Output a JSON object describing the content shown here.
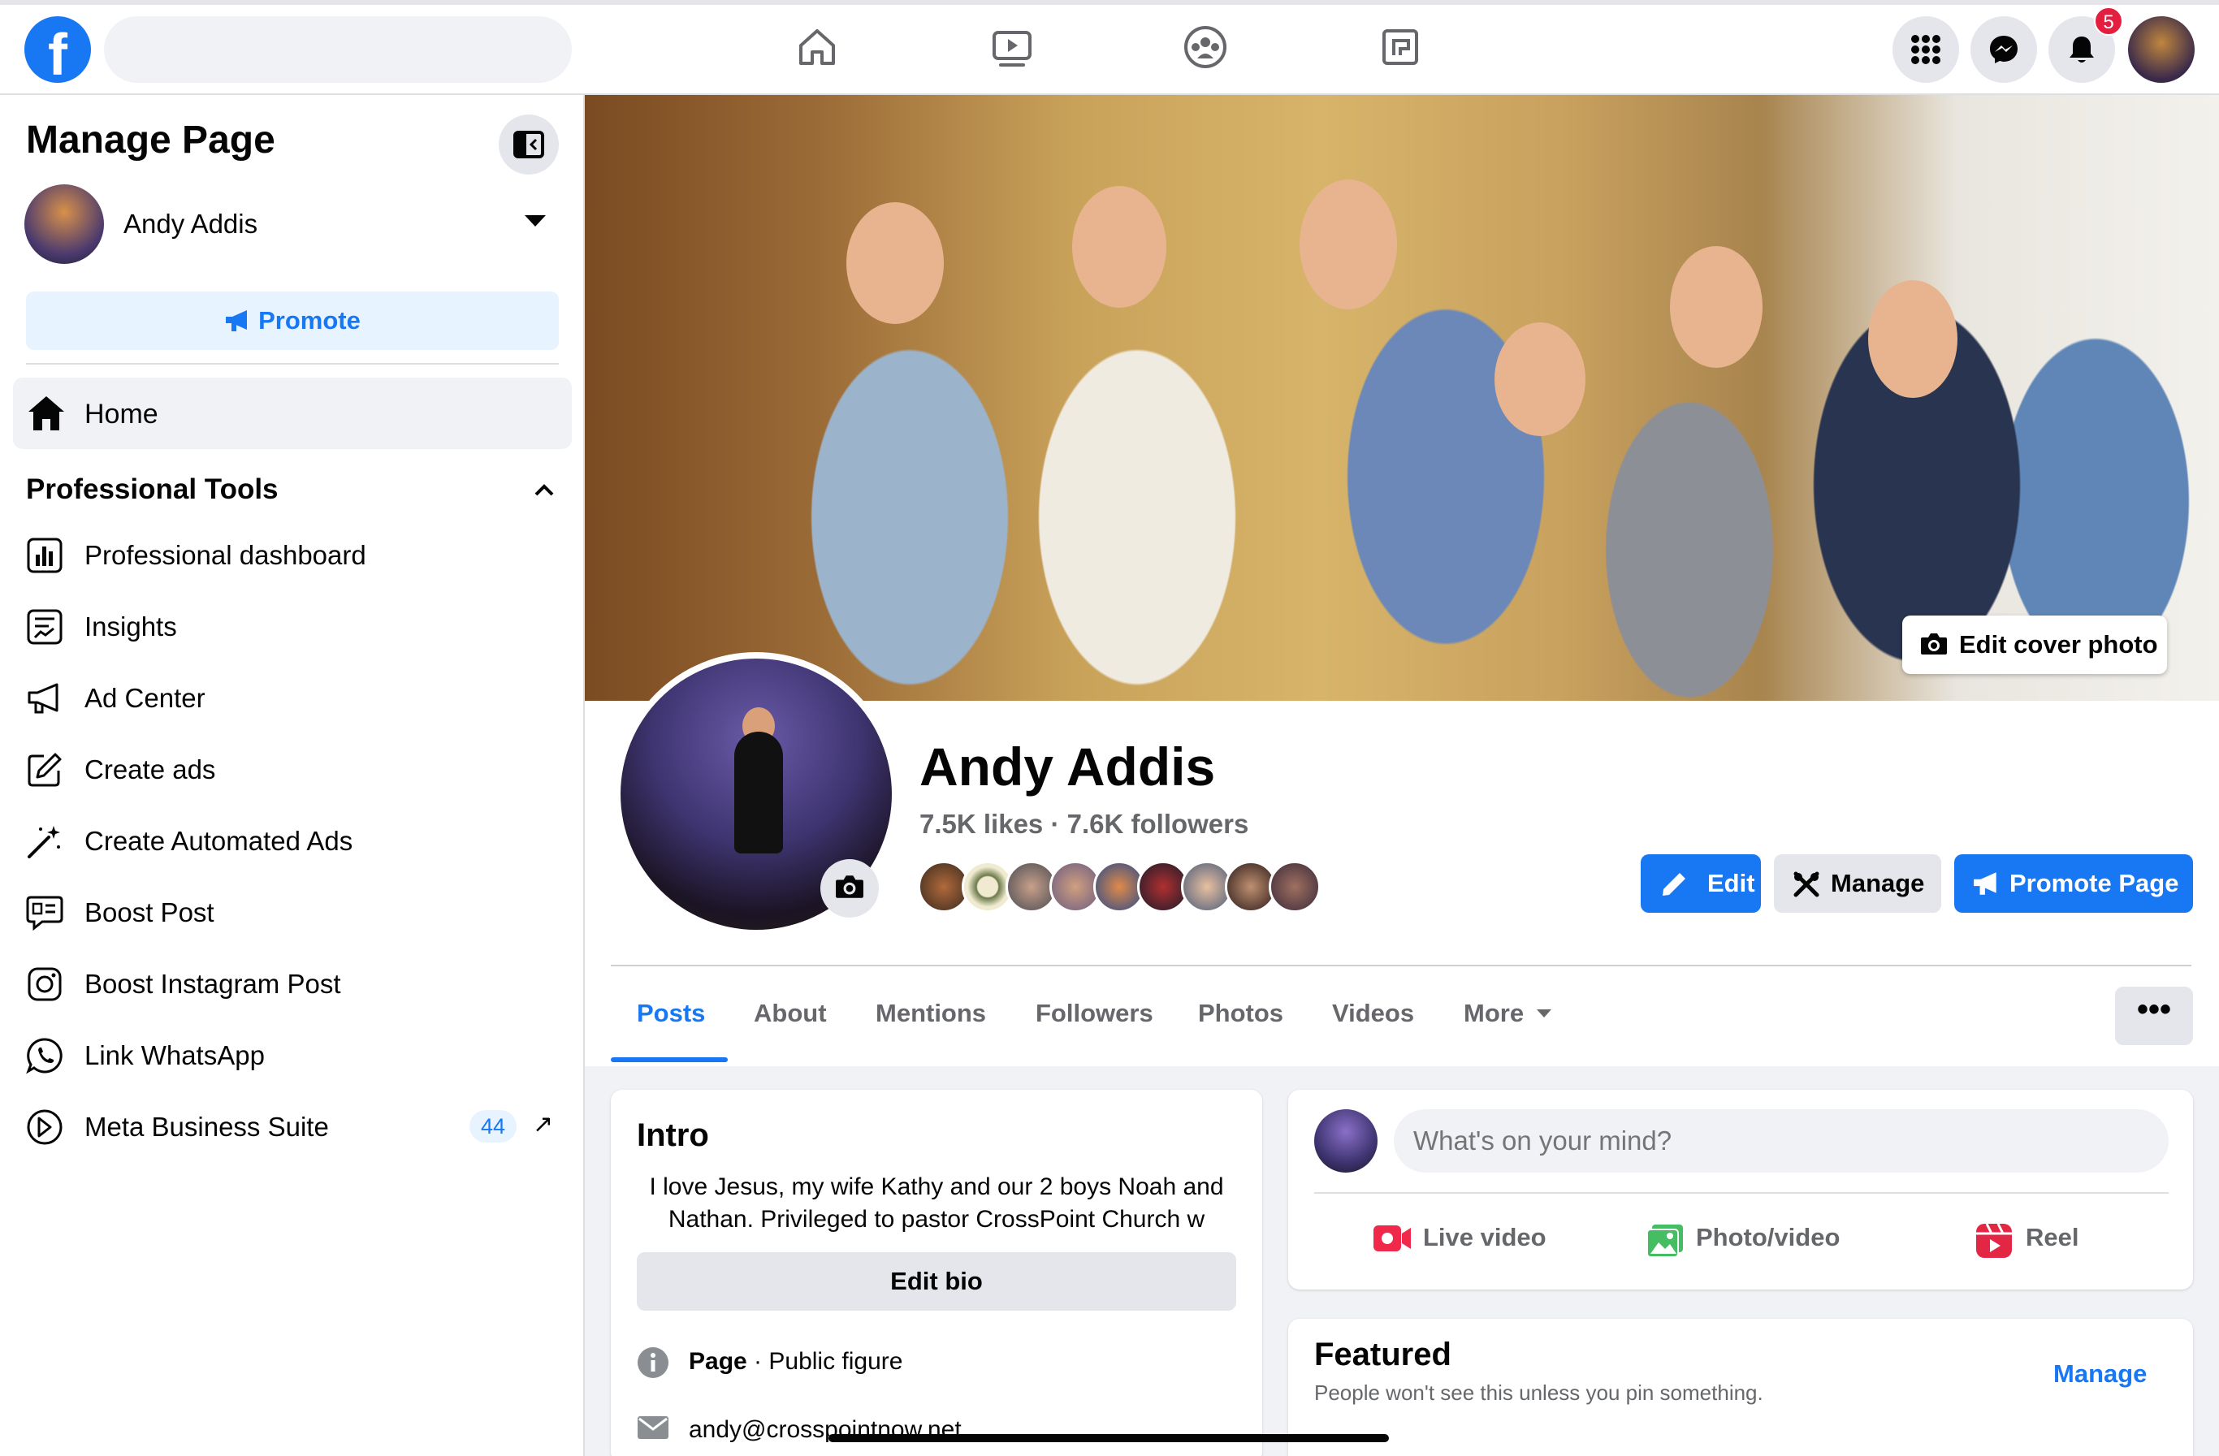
{
  "topbar": {
    "logo_letter": "f",
    "search_placeholder": "",
    "notification_count": "5",
    "nav_icons": [
      "home-icon",
      "video-icon",
      "groups-icon",
      "gaming-icon"
    ]
  },
  "sidebar": {
    "title": "Manage Page",
    "page_name": "Andy Addis",
    "promote_label": "Promote",
    "home_label": "Home",
    "section_title": "Professional Tools",
    "tools": [
      {
        "label": "Professional dashboard",
        "icon": "dashboard-icon"
      },
      {
        "label": "Insights",
        "icon": "insights-icon"
      },
      {
        "label": "Ad Center",
        "icon": "megaphone-icon"
      },
      {
        "label": "Create ads",
        "icon": "edit-square-icon"
      },
      {
        "label": "Create Automated Ads",
        "icon": "magic-wand-icon"
      },
      {
        "label": "Boost Post",
        "icon": "boost-post-icon"
      },
      {
        "label": "Boost Instagram Post",
        "icon": "instagram-icon"
      },
      {
        "label": "Link WhatsApp",
        "icon": "whatsapp-icon"
      },
      {
        "label": "Meta Business Suite",
        "icon": "business-suite-icon",
        "count": "44",
        "external": "↗"
      }
    ]
  },
  "cover": {
    "edit_label": "Edit cover photo"
  },
  "profile": {
    "name": "Andy Addis",
    "likes": "7.5K likes",
    "separator": "·",
    "followers": "7.6K followers",
    "buttons": {
      "edit": "Edit",
      "manage": "Manage",
      "promote": "Promote Page"
    }
  },
  "tabs": [
    {
      "label": "Posts",
      "active": true
    },
    {
      "label": "About"
    },
    {
      "label": "Mentions"
    },
    {
      "label": "Followers"
    },
    {
      "label": "Photos"
    },
    {
      "label": "Videos"
    },
    {
      "label": "More"
    }
  ],
  "more_menu_label": "•••",
  "intro": {
    "title": "Intro",
    "bio": "I love Jesus, my wife Kathy and our 2 boys Noah and Nathan. Privileged to pastor CrossPoint Church w",
    "edit_bio_label": "Edit bio",
    "page_type_bold": "Page",
    "page_type_rest": " · Public figure",
    "email": "andy@crosspointnow.net"
  },
  "composer": {
    "placeholder": "What's on your mind?",
    "actions": {
      "live": "Live video",
      "photo": "Photo/video",
      "reel": "Reel"
    }
  },
  "featured": {
    "title": "Featured",
    "subtitle": "People won't see this unless you pin something.",
    "manage_label": "Manage"
  },
  "colors": {
    "brand_blue": "#1877f2",
    "badge_red": "#e41e3f",
    "live_red": "#f02849",
    "photo_green": "#45bd62",
    "reel_pink": "#e42645"
  }
}
